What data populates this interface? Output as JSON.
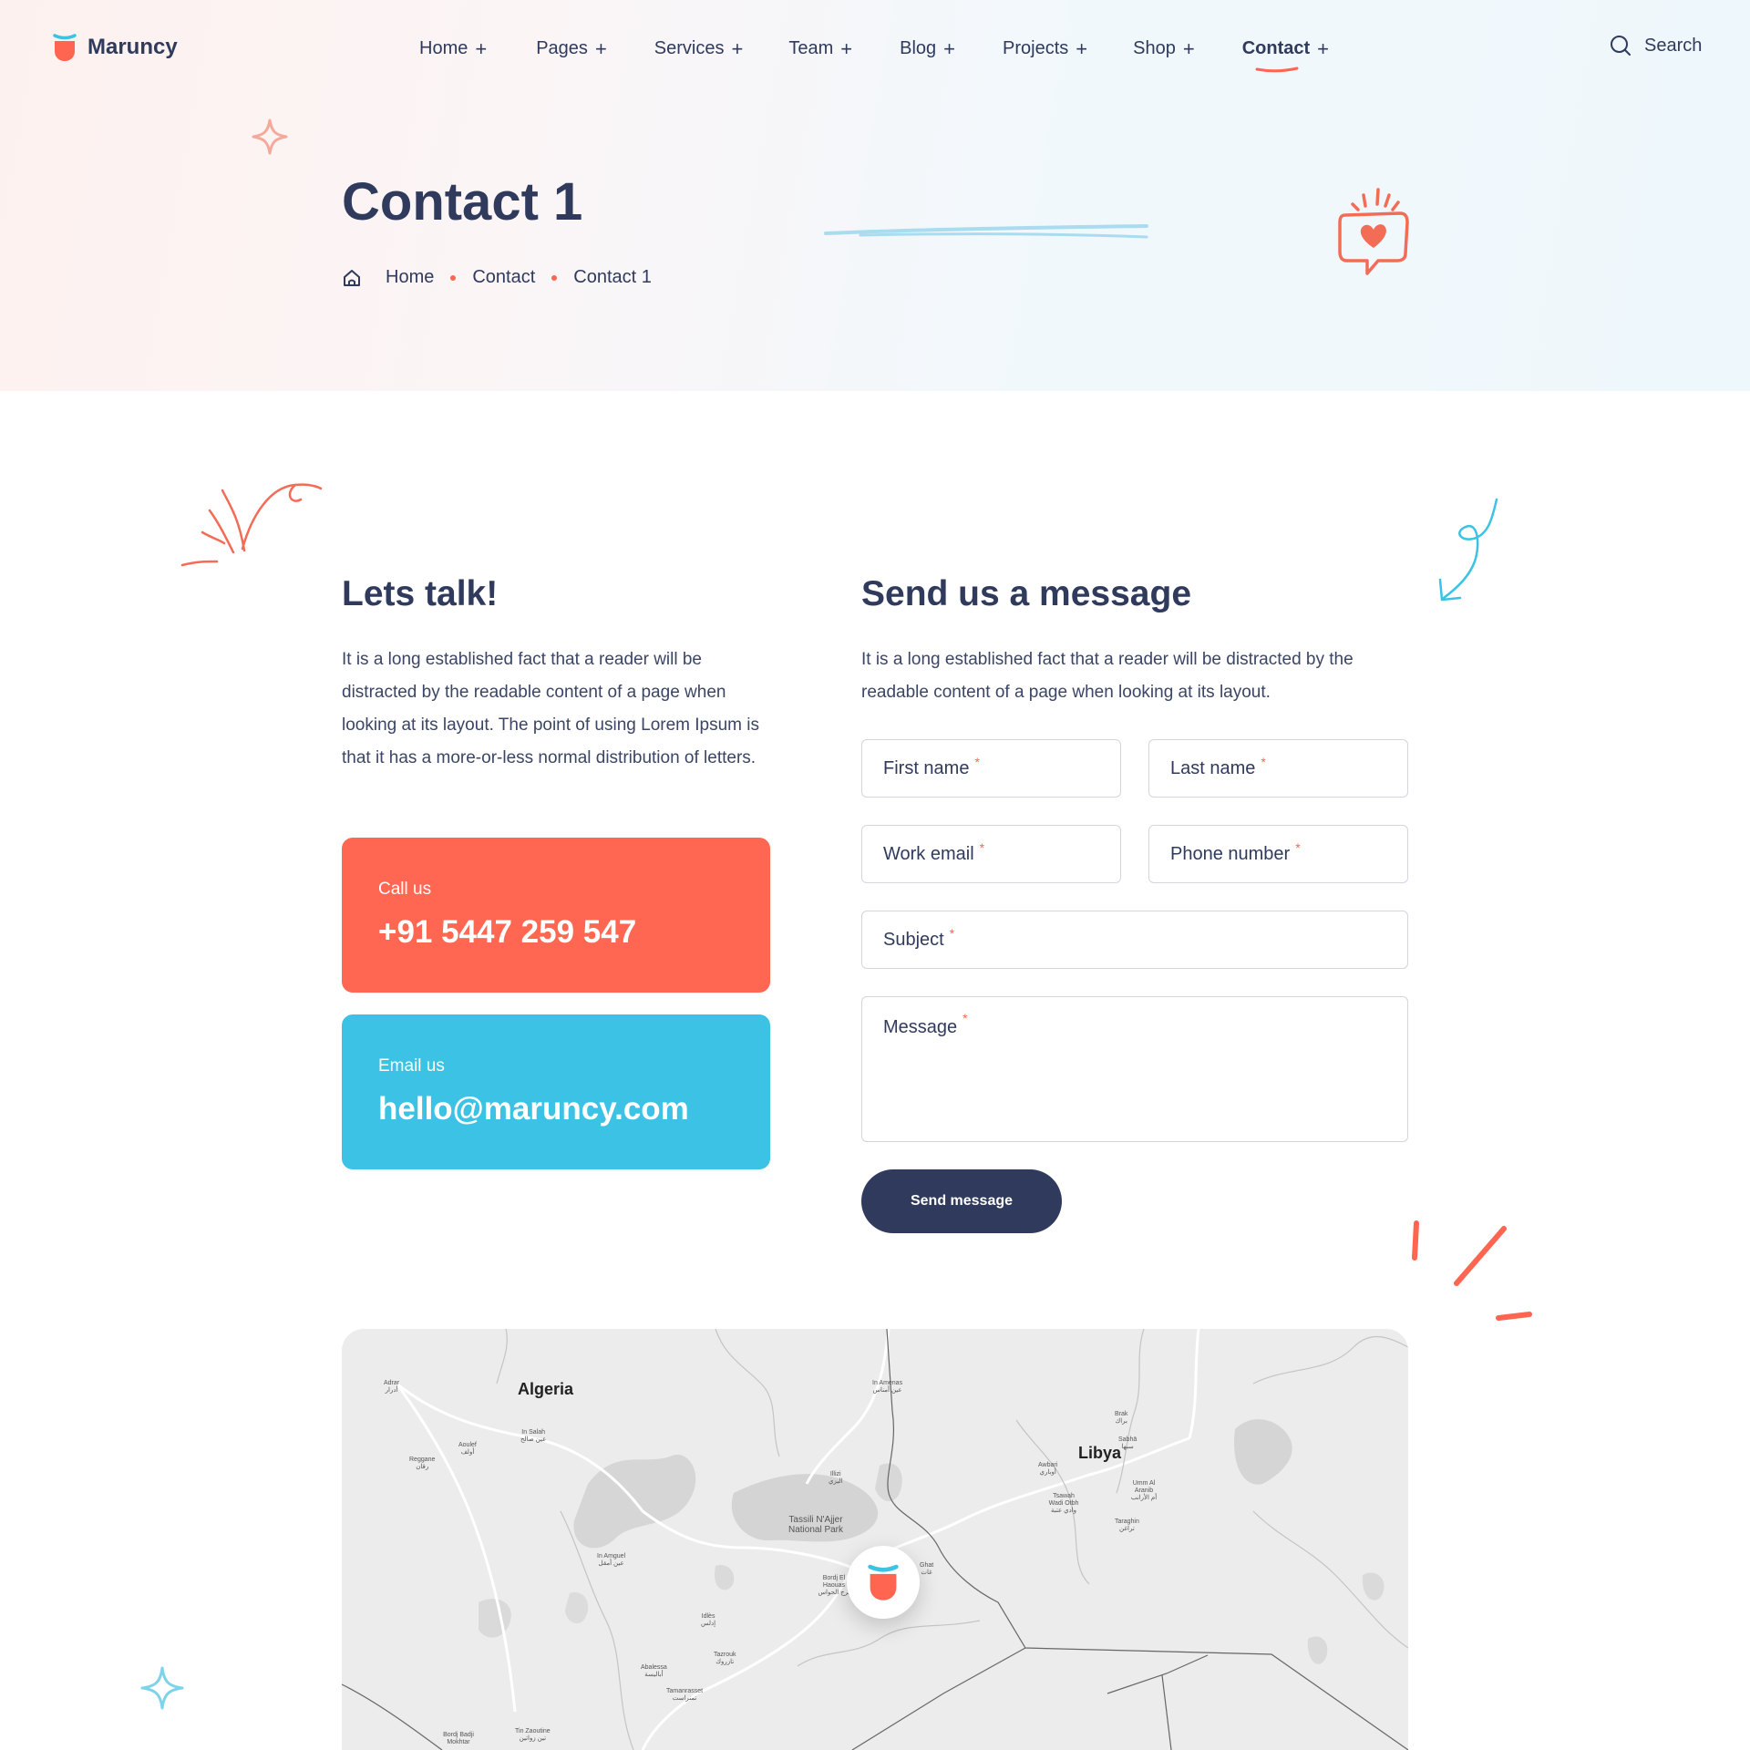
{
  "brand": {
    "name": "Maruncy",
    "accent": "#ff6550",
    "blue": "#3bc2e4",
    "navy": "#2f3a5c"
  },
  "nav": {
    "items": [
      {
        "label": "Home",
        "icon": "plus-icon"
      },
      {
        "label": "Pages",
        "icon": "plus-icon"
      },
      {
        "label": "Services",
        "icon": "plus-icon"
      },
      {
        "label": "Team",
        "icon": "plus-icon"
      },
      {
        "label": "Blog",
        "icon": "plus-icon"
      },
      {
        "label": "Projects",
        "icon": "plus-icon"
      },
      {
        "label": "Shop",
        "icon": "plus-icon"
      },
      {
        "label": "Contact",
        "icon": "plus-icon",
        "active": true
      }
    ],
    "plus": "+",
    "search_label": "Search"
  },
  "hero": {
    "title": "Contact 1",
    "breadcrumb": [
      "Home",
      "Contact",
      "Contact 1"
    ]
  },
  "talk": {
    "heading": "Lets talk!",
    "text": "It is a long established fact that a reader will be distracted by the readable content of a page when looking at its layout. The point of using Lorem Ipsum is that it has a more-or-less normal distribution of letters.",
    "call_label": "Call us",
    "call_value": "+91 5447 259 547",
    "email_label": "Email us",
    "email_value": "hello@maruncy.com"
  },
  "form": {
    "heading": "Send us a message",
    "text": "It is a long established fact that a reader will be distracted by the readable content of a page when looking at its layout.",
    "required_mark": "*",
    "first_name": "First name",
    "last_name": "Last name",
    "work_email": "Work email",
    "phone": "Phone number",
    "subject": "Subject",
    "message": "Message",
    "submit": "Send message"
  },
  "map": {
    "countries": [
      "Algeria",
      "Libya"
    ],
    "park": "Tassili N'Ajjer National Park",
    "towns": [
      {
        "name": "Adrar",
        "ar": "أدرار"
      },
      {
        "name": "In Salah",
        "ar": "عين صالح"
      },
      {
        "name": "Aoulef",
        "ar": "أولف"
      },
      {
        "name": "Reggane",
        "ar": "رقان"
      },
      {
        "name": "In Amenas",
        "ar": "عين أمناس"
      },
      {
        "name": "Illizi",
        "ar": "اليزي"
      },
      {
        "name": "Brak",
        "ar": "براك"
      },
      {
        "name": "Sabhā",
        "ar": "سبها"
      },
      {
        "name": "Awbari",
        "ar": "أوباري"
      },
      {
        "name": "Umm Al Aranib",
        "ar": "أم الأرانب"
      },
      {
        "name": "Tsawah Wadi Otbh",
        "ar": "وادي عتبة"
      },
      {
        "name": "Taraghin",
        "ar": "تراغن"
      },
      {
        "name": "In Amguel",
        "ar": "عين أمقل"
      },
      {
        "name": "Bordj El Haouas",
        "ar": "برج الحواس"
      },
      {
        "name": "Ghat",
        "ar": "غات"
      },
      {
        "name": "Idlès",
        "ar": "إدلس"
      },
      {
        "name": "Tazrouk",
        "ar": "تازروك"
      },
      {
        "name": "Abalessa",
        "ar": "أباليسة"
      },
      {
        "name": "Tamanrasset",
        "ar": "تمنراست"
      },
      {
        "name": "Bordj Badji Mokhtar",
        "ar": ""
      },
      {
        "name": "Tin Zaoutine",
        "ar": "تين زواتين"
      }
    ]
  }
}
